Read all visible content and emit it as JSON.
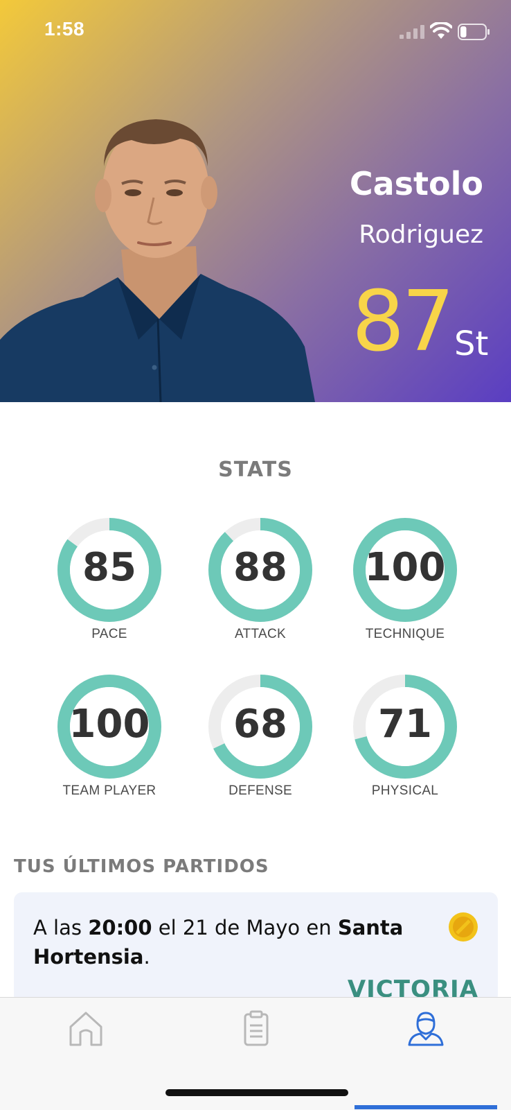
{
  "status_bar": {
    "time": "1:58",
    "battery_level": 0.25
  },
  "player": {
    "first_name": "Castolo",
    "last_name": "Rodriguez",
    "rating": "87",
    "position": "St"
  },
  "colors": {
    "gradient_start": "#f3c93a",
    "gradient_end": "#5a3ec2",
    "rating": "#f8d449",
    "ring_fill": "#6dc9b8",
    "accent": "#2f6fd8",
    "victory": "#3a8f80"
  },
  "stats": {
    "title": "STATS",
    "items": [
      {
        "label": "PACE",
        "value": 85
      },
      {
        "label": "ATTACK",
        "value": 88
      },
      {
        "label": "TECHNIQUE",
        "value": 100
      },
      {
        "label": "TEAM PLAYER",
        "value": 100
      },
      {
        "label": "DEFENSE",
        "value": 68
      },
      {
        "label": "PHYSICAL",
        "value": 71
      }
    ]
  },
  "matches": {
    "title": "TUS ÚLTIMOS PARTIDOS",
    "items": [
      {
        "prefix": "A las ",
        "time": "20:00",
        "middle": " el 21 de Mayo en ",
        "venue": "Santa Hortensia",
        "suffix": ".",
        "result": "VICTORIA",
        "icon": "gold-coin-icon"
      }
    ]
  },
  "tabbar": {
    "tabs": [
      {
        "name": "home",
        "icon": "home-icon",
        "active": false
      },
      {
        "name": "clipboard",
        "icon": "clipboard-icon",
        "active": false
      },
      {
        "name": "profile",
        "icon": "user-icon",
        "active": true
      }
    ]
  }
}
